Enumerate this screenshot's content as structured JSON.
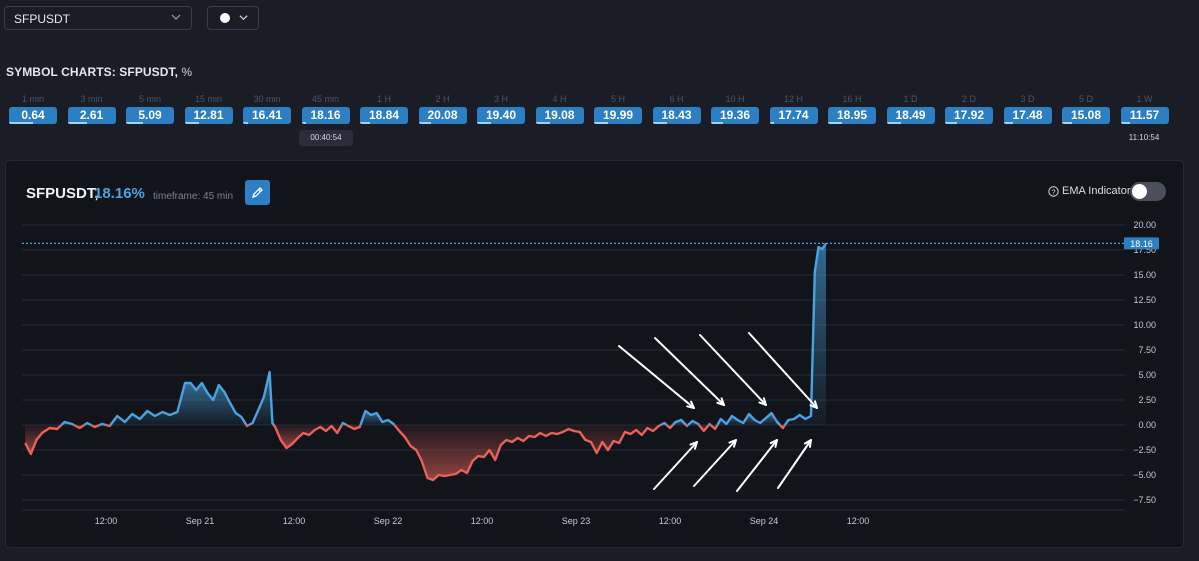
{
  "symbol_select": {
    "value": "SFPUSDT"
  },
  "color_select": {
    "value": "white",
    "color": "#ffffff"
  },
  "section_title": {
    "main": "SYMBOL CHARTS: SFPUSDT,",
    "unit": " %"
  },
  "timeframes": [
    {
      "label": "1 min",
      "value": "0.64",
      "progress": 0.5
    },
    {
      "label": "3 min",
      "value": "2.61",
      "progress": 0.4
    },
    {
      "label": "5 min",
      "value": "5.09",
      "progress": 0.35
    },
    {
      "label": "15 min",
      "value": "12.81",
      "progress": 0.3
    },
    {
      "label": "30 min",
      "value": "16.41",
      "progress": 0.1
    },
    {
      "label": "45 min",
      "value": "18.16",
      "progress": 0.1
    },
    {
      "label": "1 H",
      "value": "18.84",
      "progress": 0.2
    },
    {
      "label": "2 H",
      "value": "20.08",
      "progress": 0.25
    },
    {
      "label": "3 H",
      "value": "19.40",
      "progress": 0.3
    },
    {
      "label": "4 H",
      "value": "19.08",
      "progress": 0.3
    },
    {
      "label": "5 H",
      "value": "19.99",
      "progress": 0.3
    },
    {
      "label": "6 H",
      "value": "18.43",
      "progress": 0.3
    },
    {
      "label": "10 H",
      "value": "19.36",
      "progress": 0.25
    },
    {
      "label": "12 H",
      "value": "17.74",
      "progress": 0.1
    },
    {
      "label": "16 H",
      "value": "18.95",
      "progress": 0.3
    },
    {
      "label": "1 D",
      "value": "18.49",
      "progress": 0.3
    },
    {
      "label": "2 D",
      "value": "17.92",
      "progress": 0.25
    },
    {
      "label": "3 D",
      "value": "17.48",
      "progress": 0.2
    },
    {
      "label": "5 D",
      "value": "15.08",
      "progress": 0.2
    },
    {
      "label": "1 W",
      "value": "11.57",
      "progress": 0.2
    }
  ],
  "countdowns": {
    "tf_45min": "00:40:54",
    "tf_1w": "11:10:54"
  },
  "chart_header": {
    "symbol": "SFPUSDT,",
    "change": "18.16%",
    "timeframe_text": "timeframe: 45 min",
    "ema_label": "EMA Indicator",
    "ema_enabled": false
  },
  "colors": {
    "positive": "#4aa3df",
    "negative": "#e8615a",
    "accent": "#2c7fc3",
    "background": "#12141b"
  },
  "chart_data": {
    "type": "area",
    "title": "",
    "current_value": 18.16,
    "current_label": "18.16",
    "ylim": [
      -9,
      21.5
    ],
    "yticks": [
      20,
      17.5,
      15,
      12.5,
      10,
      7.5,
      5,
      2.5,
      0,
      -2.5,
      -5,
      -7.5
    ],
    "ytick_labels": [
      "20.00",
      "17.50",
      "15.00",
      "12.50",
      "10.00",
      "7.50",
      "5.00",
      "2.50",
      "0.00",
      "−2.50",
      "−5.00",
      "−7.50"
    ],
    "x_range_days": [
      -0.85,
      4.15
    ],
    "x_ticks": [
      {
        "label": "12:00",
        "day": -0.5
      },
      {
        "label": "Sep 21",
        "day": 0
      },
      {
        "label": "12:00",
        "day": 0.5
      },
      {
        "label": "Sep 22",
        "day": 1
      },
      {
        "label": "12:00",
        "day": 1.5
      },
      {
        "label": "Sep 23",
        "day": 2
      },
      {
        "label": "12:00",
        "day": 2.5
      },
      {
        "label": "Sep 24",
        "day": 3
      },
      {
        "label": "12:00",
        "day": 3.5
      }
    ],
    "series": [
      {
        "points": [
          [
            -0.93,
            -1.8
          ],
          [
            -0.9,
            -2.9
          ],
          [
            -0.87,
            -1.5
          ],
          [
            -0.84,
            -0.8
          ],
          [
            -0.8,
            -0.3
          ],
          [
            -0.76,
            -0.4
          ],
          [
            -0.72,
            0.3
          ],
          [
            -0.68,
            0.1
          ],
          [
            -0.64,
            -0.3
          ],
          [
            -0.6,
            0.2
          ],
          [
            -0.56,
            -0.2
          ],
          [
            -0.52,
            0.1
          ],
          [
            -0.48,
            -0.1
          ],
          [
            -0.44,
            0.9
          ],
          [
            -0.4,
            0.3
          ],
          [
            -0.36,
            1.1
          ],
          [
            -0.32,
            0.6
          ],
          [
            -0.28,
            1.4
          ],
          [
            -0.24,
            0.9
          ],
          [
            -0.2,
            1.3
          ],
          [
            -0.16,
            1.0
          ],
          [
            -0.12,
            1.3
          ],
          [
            -0.08,
            4.2
          ],
          [
            -0.05,
            4.2
          ],
          [
            -0.02,
            3.5
          ],
          [
            0.01,
            4.2
          ],
          [
            0.04,
            3.2
          ],
          [
            0.07,
            2.5
          ],
          [
            0.1,
            4.0
          ],
          [
            0.13,
            3.3
          ],
          [
            0.16,
            2.2
          ],
          [
            0.19,
            1.2
          ],
          [
            0.22,
            0.8
          ],
          [
            0.25,
            -0.1
          ],
          [
            0.28,
            0.2
          ],
          [
            0.31,
            1.5
          ],
          [
            0.34,
            2.8
          ],
          [
            0.37,
            5.3
          ],
          [
            0.385,
            0.2
          ],
          [
            0.4,
            -0.2
          ],
          [
            0.43,
            -1.5
          ],
          [
            0.46,
            -2.3
          ],
          [
            0.49,
            -1.9
          ],
          [
            0.52,
            -1.3
          ],
          [
            0.55,
            -0.8
          ],
          [
            0.58,
            -1.0
          ],
          [
            0.61,
            -0.5
          ],
          [
            0.64,
            -0.2
          ],
          [
            0.67,
            -0.6
          ],
          [
            0.7,
            -0.1
          ],
          [
            0.73,
            -0.8
          ],
          [
            0.76,
            0.2
          ],
          [
            0.79,
            -0.1
          ],
          [
            0.82,
            -0.4
          ],
          [
            0.85,
            -0.2
          ],
          [
            0.88,
            1.4
          ],
          [
            0.91,
            1.0
          ],
          [
            0.94,
            1.2
          ],
          [
            0.97,
            0.3
          ],
          [
            1.0,
            0.5
          ],
          [
            1.03,
            0.1
          ],
          [
            1.06,
            -0.6
          ],
          [
            1.09,
            -1.2
          ],
          [
            1.12,
            -2.1
          ],
          [
            1.15,
            -2.5
          ],
          [
            1.18,
            -3.6
          ],
          [
            1.21,
            -5.3
          ],
          [
            1.24,
            -5.5
          ],
          [
            1.27,
            -5.0
          ],
          [
            1.3,
            -5.1
          ],
          [
            1.33,
            -5.0
          ],
          [
            1.36,
            -4.9
          ],
          [
            1.39,
            -4.5
          ],
          [
            1.42,
            -4.8
          ],
          [
            1.45,
            -3.6
          ],
          [
            1.48,
            -3.1
          ],
          [
            1.51,
            -3.2
          ],
          [
            1.54,
            -2.5
          ],
          [
            1.57,
            -3.5
          ],
          [
            1.6,
            -2.0
          ],
          [
            1.63,
            -1.5
          ],
          [
            1.66,
            -1.7
          ],
          [
            1.69,
            -1.3
          ],
          [
            1.72,
            -1.6
          ],
          [
            1.75,
            -1.1
          ],
          [
            1.78,
            -1.2
          ],
          [
            1.81,
            -0.8
          ],
          [
            1.84,
            -1.1
          ],
          [
            1.87,
            -0.8
          ],
          [
            1.9,
            -0.9
          ],
          [
            1.93,
            -0.7
          ],
          [
            1.96,
            -0.4
          ],
          [
            1.99,
            -0.6
          ],
          [
            2.02,
            -0.7
          ],
          [
            2.05,
            -1.5
          ],
          [
            2.08,
            -1.7
          ],
          [
            2.11,
            -2.8
          ],
          [
            2.14,
            -1.7
          ],
          [
            2.17,
            -2.5
          ],
          [
            2.2,
            -1.6
          ],
          [
            2.23,
            -1.8
          ],
          [
            2.26,
            -0.7
          ],
          [
            2.29,
            -0.9
          ],
          [
            2.32,
            -0.5
          ],
          [
            2.35,
            -1.0
          ],
          [
            2.38,
            -0.3
          ],
          [
            2.41,
            -0.6
          ],
          [
            2.44,
            -0.1
          ],
          [
            2.47,
            0.2
          ],
          [
            2.5,
            -0.3
          ],
          [
            2.53,
            0.3
          ],
          [
            2.56,
            0.5
          ],
          [
            2.59,
            -0.1
          ],
          [
            2.62,
            0.4
          ],
          [
            2.65,
            0.1
          ],
          [
            2.68,
            -0.6
          ],
          [
            2.71,
            0.1
          ],
          [
            2.74,
            -0.4
          ],
          [
            2.77,
            0.6
          ],
          [
            2.8,
            0.1
          ],
          [
            2.83,
            0.9
          ],
          [
            2.86,
            0.5
          ],
          [
            2.89,
            0.2
          ],
          [
            2.92,
            1.1
          ],
          [
            2.95,
            0.5
          ],
          [
            2.98,
            0.2
          ],
          [
            3.01,
            0.7
          ],
          [
            3.04,
            1.2
          ],
          [
            3.07,
            0.3
          ],
          [
            3.1,
            -0.3
          ],
          [
            3.13,
            0.5
          ],
          [
            3.16,
            0.6
          ],
          [
            3.19,
            1.0
          ],
          [
            3.22,
            0.6
          ],
          [
            3.25,
            0.9
          ],
          [
            3.27,
            15.3
          ],
          [
            3.29,
            17.8
          ],
          [
            3.31,
            17.6
          ],
          [
            3.33,
            18.16
          ]
        ]
      }
    ]
  }
}
